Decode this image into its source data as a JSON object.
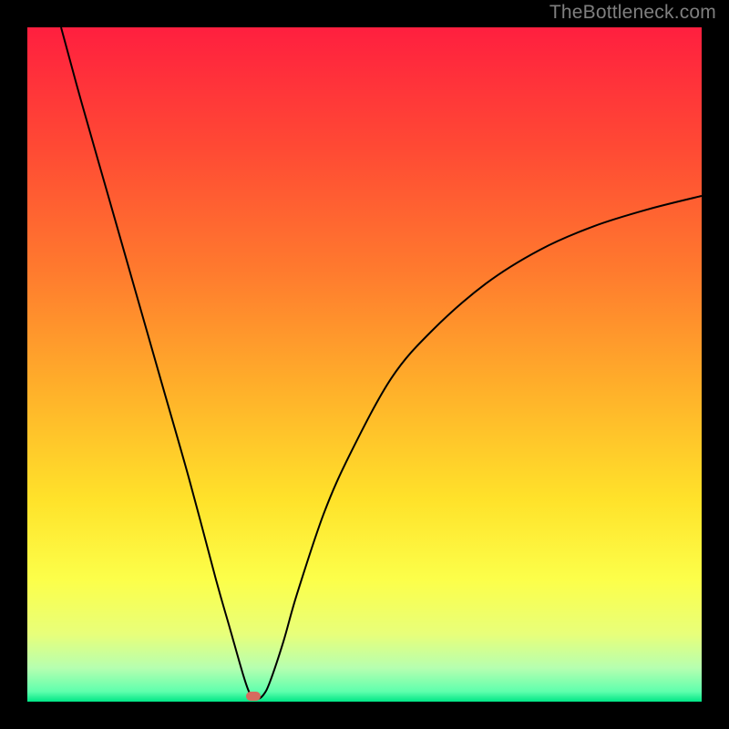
{
  "watermark": "TheBottleneck.com",
  "colors": {
    "page_bg": "#000000",
    "curve_stroke": "#000000",
    "marker_fill": "#d66b5f",
    "watermark_text": "#7f7f7f",
    "gradient_stops": [
      {
        "offset": 0.0,
        "color": "#ff1f3f"
      },
      {
        "offset": 0.18,
        "color": "#ff4a34"
      },
      {
        "offset": 0.36,
        "color": "#ff7a2e"
      },
      {
        "offset": 0.54,
        "color": "#ffb12a"
      },
      {
        "offset": 0.7,
        "color": "#ffe22a"
      },
      {
        "offset": 0.82,
        "color": "#fcff4a"
      },
      {
        "offset": 0.9,
        "color": "#e8ff7a"
      },
      {
        "offset": 0.95,
        "color": "#b6ffb0"
      },
      {
        "offset": 0.985,
        "color": "#5fffad"
      },
      {
        "offset": 1.0,
        "color": "#00e686"
      }
    ]
  },
  "chart_data": {
    "type": "line",
    "title": "",
    "xlabel": "",
    "ylabel": "",
    "xlim": [
      0,
      100
    ],
    "ylim": [
      0,
      100
    ],
    "grid": false,
    "legend": false,
    "series": [
      {
        "name": "bottleneck-curve",
        "x": [
          5,
          8,
          12,
          16,
          20,
          24,
          28,
          30,
          32,
          33,
          34,
          35,
          36,
          38,
          40,
          44,
          48,
          54,
          60,
          68,
          76,
          84,
          92,
          100
        ],
        "y": [
          100,
          89,
          75,
          61,
          47,
          33,
          18,
          11,
          4,
          1.2,
          0.4,
          1.0,
          3,
          9,
          16,
          28,
          37,
          48,
          55,
          62,
          67,
          70.5,
          73,
          75
        ]
      }
    ],
    "annotations": [
      {
        "name": "min-marker",
        "x": 33.5,
        "y": 0.8
      }
    ]
  }
}
